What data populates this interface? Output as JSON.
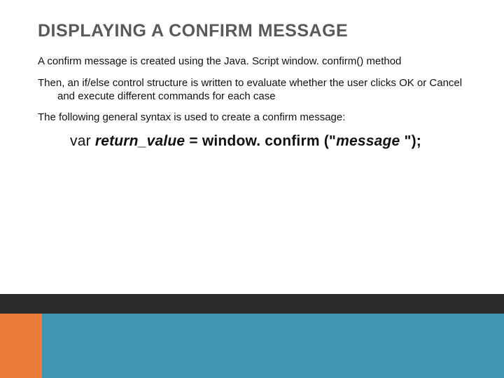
{
  "title": "DISPLAYING A CONFIRM MESSAGE",
  "p1": "A confirm message is created using the Java. Script window. confirm() method",
  "p2": "Then, an if/else control structure is written to evaluate whether the user clicks OK or Cancel and execute different commands for each case",
  "p3": "The following general syntax is used to create a confirm message:",
  "syntax": {
    "kw_var": "var",
    "ret": "return_value",
    "eq": " = window. confirm (\"",
    "msg": "message ",
    "end": "\");"
  }
}
